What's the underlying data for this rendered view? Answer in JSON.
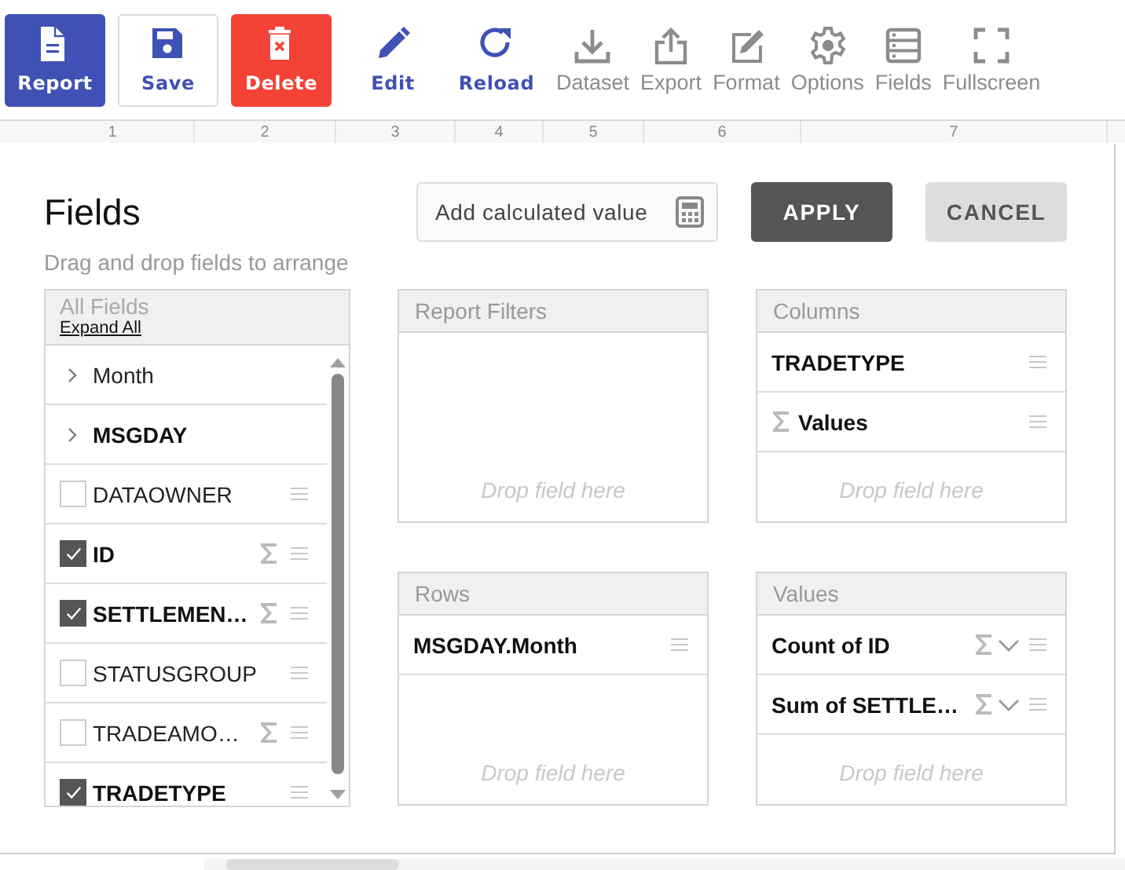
{
  "toolbar": [
    {
      "label": "Report",
      "kind": "primary"
    },
    {
      "label": "Save",
      "kind": "outline"
    },
    {
      "label": "Delete",
      "kind": "danger"
    },
    {
      "label": "Edit",
      "kind": "action"
    },
    {
      "label": "Reload",
      "kind": "action"
    },
    {
      "label": "Dataset",
      "kind": "tool"
    },
    {
      "label": "Export",
      "kind": "tool"
    },
    {
      "label": "Format",
      "kind": "tool"
    },
    {
      "label": "Options",
      "kind": "tool"
    },
    {
      "label": "Fields",
      "kind": "tool"
    },
    {
      "label": "Fullscreen",
      "kind": "tool"
    }
  ],
  "ruler": [
    "1",
    "2",
    "3",
    "4",
    "5",
    "6",
    "7"
  ],
  "dialog": {
    "title": "Fields",
    "subtitle": "Drag and drop fields to arrange",
    "calculated_button": "Add calculated value",
    "apply": "APPLY",
    "cancel": "CANCEL",
    "all_fields": {
      "title": "All Fields",
      "expand_all": "Expand All",
      "items": [
        {
          "kind": "group",
          "label": "Month",
          "active": false
        },
        {
          "kind": "group",
          "label": "MSGDAY",
          "active": true
        },
        {
          "kind": "field",
          "label": "DATAOWNER",
          "checked": false,
          "numeric": false
        },
        {
          "kind": "field",
          "label": "ID",
          "checked": true,
          "numeric": true
        },
        {
          "kind": "field",
          "label": "SETTLEMEN…",
          "checked": true,
          "numeric": true
        },
        {
          "kind": "field",
          "label": "STATUSGROUP",
          "checked": false,
          "numeric": false
        },
        {
          "kind": "field",
          "label": "TRADEAMO…",
          "checked": false,
          "numeric": true
        },
        {
          "kind": "field",
          "label": "TRADETYPE",
          "checked": true,
          "numeric": false
        }
      ]
    },
    "zones": [
      {
        "title": "Report Filters",
        "drop_text": "Drop field here"
      },
      {
        "title": "Columns",
        "drop_text": "Drop field here",
        "items": [
          {
            "kind": "field",
            "label": "TRADETYPE"
          },
          {
            "kind": "values",
            "label": "Values"
          }
        ]
      },
      {
        "title": "Rows",
        "drop_text": "Drop field here",
        "items": [
          {
            "kind": "field",
            "label": "MSGDAY.Month"
          }
        ]
      },
      {
        "title": "Values",
        "drop_text": "Drop field here",
        "items": [
          {
            "kind": "measure",
            "label": "Count of ID"
          },
          {
            "kind": "measure",
            "label": "Sum of SETTLE…"
          }
        ]
      }
    ]
  }
}
